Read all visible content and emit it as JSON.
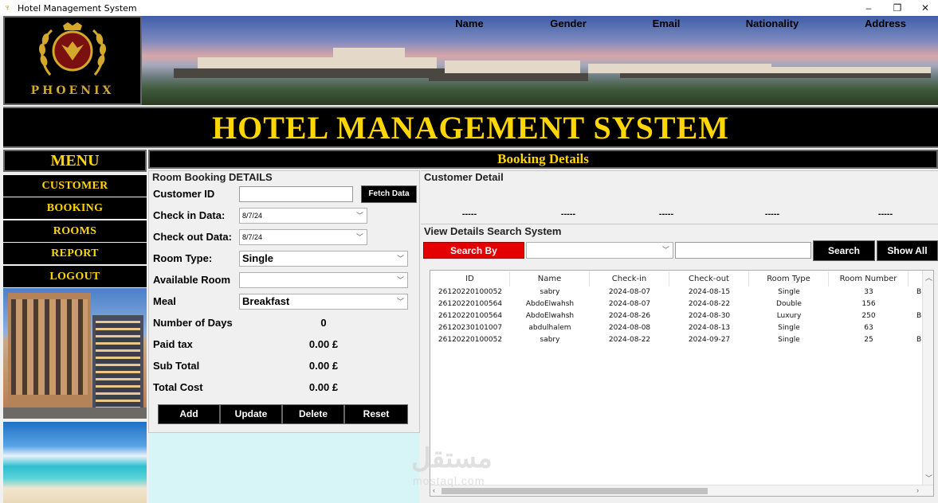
{
  "window": {
    "title": "Hotel Management System",
    "controls": [
      "minimize-icon",
      "restore-icon",
      "close-icon"
    ]
  },
  "logo": {
    "text": "PHOENIX"
  },
  "heading": "HOTEL MANAGEMENT SYSTEM",
  "menu": {
    "title": "MENU",
    "items": [
      "CUSTOMER",
      "BOOKING",
      "ROOMS",
      "REPORT",
      "LOGOUT"
    ]
  },
  "section_title": "Booking Details",
  "room_booking": {
    "group_label": "Room Booking DETAILS",
    "customer_id_label": "Customer ID",
    "customer_id_value": "",
    "fetch_button": "Fetch Data",
    "checkin_label": "Check in Data:",
    "checkin_value": "8/7/24",
    "checkout_label": "Check out Data:",
    "checkout_value": "8/7/24",
    "room_type_label": "Room Type:",
    "room_type_value": "Single",
    "available_room_label": "Available Room",
    "available_room_value": "",
    "meal_label": "Meal",
    "meal_value": "Breakfast",
    "days_label": "Number of Days",
    "days_value": "0",
    "tax_label": "Paid tax",
    "tax_value": "0.00 £",
    "subtotal_label": "Sub Total",
    "subtotal_value": "0.00 £",
    "total_label": "Total Cost",
    "total_value": "0.00 £",
    "buttons": {
      "add": "Add",
      "update": "Update",
      "delete": "Delete",
      "reset": "Reset"
    }
  },
  "customer_detail": {
    "group_label": "Customer Detail",
    "columns": [
      "Name",
      "Gender",
      "Email",
      "Nationality",
      "Address"
    ],
    "values": [
      "-----",
      "-----",
      "-----",
      "-----",
      "-----"
    ]
  },
  "search": {
    "group_label": "View Details Search System",
    "search_by_label": "Search By",
    "field_value": "",
    "query_value": "",
    "search_button": "Search",
    "show_all_button": "Show All"
  },
  "table": {
    "columns": [
      "ID",
      "Name",
      "Check-in",
      "Check-out",
      "Room Type",
      "Room Number"
    ],
    "overflow_column_initial": "B",
    "rows": [
      [
        "26120220100052",
        "sabry",
        "2024-08-07",
        "2024-08-15",
        "Single",
        "33",
        "B"
      ],
      [
        "26120220100564",
        "AbdoElwahsh",
        "2024-08-07",
        "2024-08-22",
        "Double",
        "156",
        ""
      ],
      [
        "26120220100564",
        "AbdoElwahsh",
        "2024-08-26",
        "2024-08-30",
        "Luxury",
        "250",
        "B"
      ],
      [
        "26120230101007",
        "abdulhalem",
        "2024-08-08",
        "2024-08-13",
        "Single",
        "63",
        ""
      ],
      [
        "26120220100052",
        "sabry",
        "2024-08-22",
        "2024-09-27",
        "Single",
        "25",
        "B"
      ]
    ]
  },
  "watermark": {
    "main": "مستقل",
    "sub": "mostaql.com"
  },
  "colors": {
    "gold": "#ffd700",
    "black": "#000000",
    "red": "#e40000",
    "cyan_fill": "#d7f4f6"
  }
}
